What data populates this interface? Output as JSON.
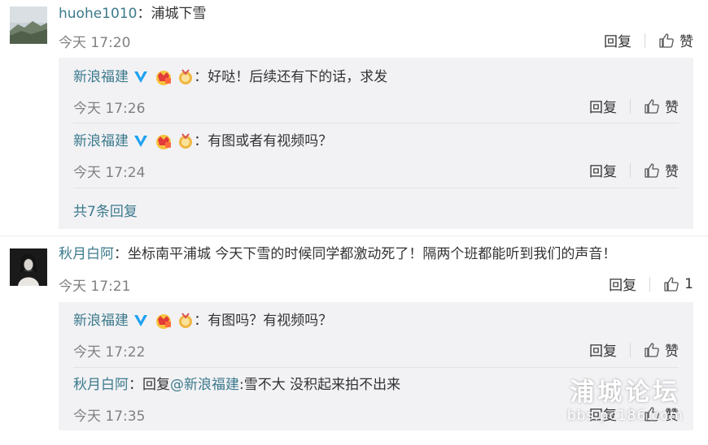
{
  "comments": [
    {
      "user": "huohe1010",
      "colon": "：",
      "text": "浦城下雪",
      "time": "今天 17:20",
      "reply_label": "回复",
      "like_label": "赞",
      "replies": [
        {
          "user": "新浪福建",
          "colon": "：",
          "text": "好哒！后续还有下的话，求发",
          "time": "今天 17:26",
          "reply_label": "回复",
          "like_label": "赞"
        },
        {
          "user": "新浪福建",
          "colon": "：",
          "text": "有图或者有视频吗？",
          "time": "今天 17:24",
          "reply_label": "回复",
          "like_label": "赞"
        }
      ],
      "more_replies": "共7条回复"
    },
    {
      "user": "秋月白阿",
      "colon": "：",
      "text": "坐标南平浦城 今天下雪的时候同学都激动死了！隔两个班都能听到我们的声音！",
      "time": "今天 17:21",
      "reply_label": "回复",
      "like_count": "1",
      "replies": [
        {
          "user": "新浪福建",
          "colon": "：",
          "text": "有图吗？有视频吗？",
          "time": "今天 17:22",
          "reply_label": "回复",
          "like_label": "赞"
        },
        {
          "user": "秋月白阿",
          "colon": "：",
          "reply_prefix": "回复",
          "mention": "@新浪福建",
          "text": ":雪不大 没积起来拍不出来",
          "time": "今天 17:35",
          "reply_label": "回复",
          "like_label": "赞"
        }
      ]
    }
  ],
  "watermark": {
    "line1": "浦城论坛",
    "line2": "bbs.pc186.com"
  },
  "colors": {
    "username": "#3c7a8c",
    "reply_bg": "#f2f2f5",
    "time": "#808080"
  },
  "icons": {
    "like": "thumbs-up-icon",
    "verified": "verified-v-icon",
    "vip": "crown-badge-icon",
    "medal": "medal-badge-icon"
  }
}
